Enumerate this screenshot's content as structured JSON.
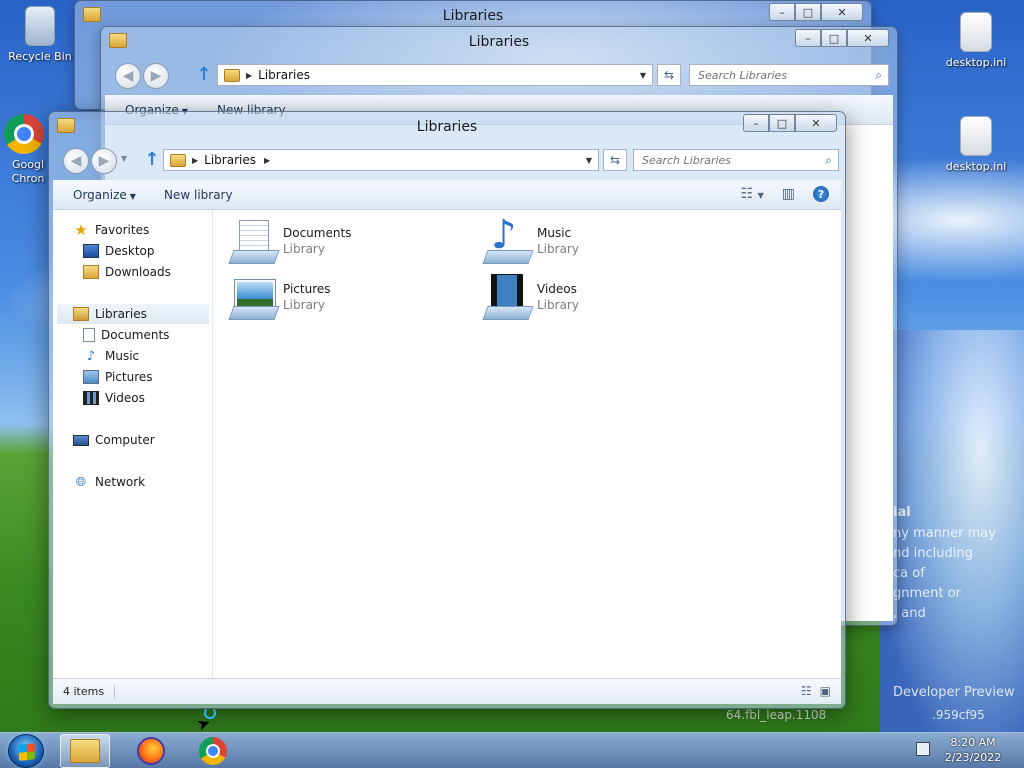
{
  "desktop": {
    "icons": [
      {
        "label": "Recycle Bin",
        "icon": "recycle-bin-icon"
      },
      {
        "label": "Googl Chron",
        "icon": "chrome-icon"
      },
      {
        "label": "desktop.ini",
        "icon": "settings-file-icon"
      },
      {
        "label": "desktop.ini",
        "icon": "settings-file-icon"
      }
    ],
    "wallpaper_text": [
      "ial",
      "ny manner may",
      "nd including",
      "ca of",
      "gnment or",
      ", and",
      "Developer Preview",
      "64.fbl_leap.1108",
      ".959cf95"
    ]
  },
  "back_window_1": {
    "title": "Libraries"
  },
  "back_window_2": {
    "title": "Libraries",
    "address": "Libraries",
    "search_placeholder": "Search Libraries",
    "organize": "Organize",
    "new_library": "New library"
  },
  "window": {
    "title": "Libraries",
    "address": {
      "crumb": "Libraries"
    },
    "search_placeholder": "Search Libraries",
    "toolbar": {
      "organize": "Organize",
      "new_library": "New library"
    },
    "nav": {
      "favorites": "Favorites",
      "desktop": "Desktop",
      "downloads": "Downloads",
      "libraries": "Libraries",
      "documents": "Documents",
      "music": "Music",
      "pictures": "Pictures",
      "videos": "Videos",
      "computer": "Computer",
      "network": "Network"
    },
    "items": [
      {
        "name": "Documents",
        "type": "Library",
        "icon": "documents-library-icon"
      },
      {
        "name": "Music",
        "type": "Library",
        "icon": "music-library-icon"
      },
      {
        "name": "Pictures",
        "type": "Library",
        "icon": "pictures-library-icon"
      },
      {
        "name": "Videos",
        "type": "Library",
        "icon": "videos-library-icon"
      }
    ],
    "status": "4 items"
  },
  "taskbar": {
    "apps": [
      "Windows Explorer",
      "Firefox",
      "Google Chrome"
    ],
    "time": "8:20 AM",
    "date": "2/23/2022"
  },
  "colors": {
    "accent": "#1e395b",
    "selection": "#dfeaf6",
    "secondary_text": "#7d7d7d"
  }
}
